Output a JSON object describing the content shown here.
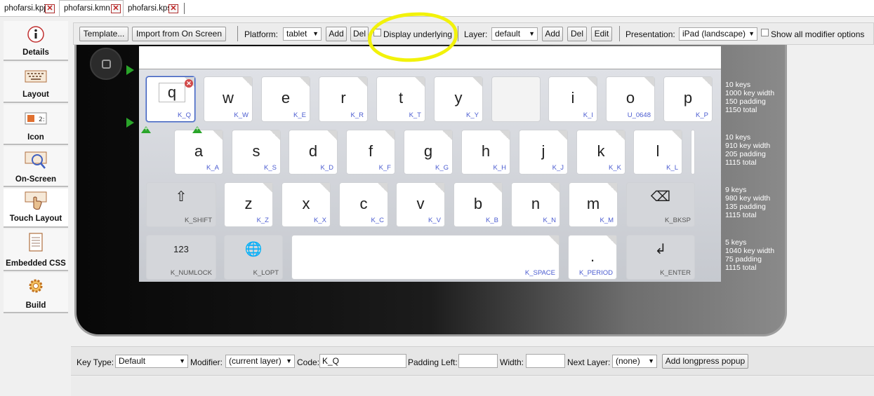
{
  "file_tabs": [
    {
      "label": "phofarsi.kpj",
      "active": false
    },
    {
      "label": "phofarsi.kmn",
      "active": true
    },
    {
      "label": "phofarsi.kps",
      "active": false
    }
  ],
  "sidebar": {
    "items": [
      {
        "label": "Details",
        "icon": "info-icon"
      },
      {
        "label": "Layout",
        "icon": "keyboard-icon"
      },
      {
        "label": "Icon",
        "icon": "bitmap-icon"
      },
      {
        "label": "On-Screen",
        "icon": "on-screen-keyboard-icon"
      },
      {
        "label": "Touch Layout",
        "icon": "touch-icon",
        "active": true
      },
      {
        "label": "Embedded CSS",
        "icon": "document-icon"
      },
      {
        "label": "Build",
        "icon": "gear-icon"
      }
    ]
  },
  "toolbar": {
    "template_label": "Template...",
    "import_label": "Import from On Screen",
    "platform_label": "Platform:",
    "platform_value": "tablet",
    "platform_add": "Add",
    "platform_del": "Del",
    "display_underlying": "Display underlying",
    "layer_label": "Layer:",
    "layer_value": "default",
    "layer_add": "Add",
    "layer_del": "Del",
    "layer_edit": "Edit",
    "presentation_label": "Presentation:",
    "presentation_value": "iPad (landscape)",
    "show_all_modifiers": "Show all modifier options"
  },
  "keyboard": {
    "rows": [
      {
        "info": [
          "10 keys",
          "1000 key width",
          "150 padding",
          "1150 total"
        ],
        "keys": [
          {
            "cap": "q",
            "code": "K_Q",
            "selected": true
          },
          {
            "cap": "w",
            "code": "K_W"
          },
          {
            "cap": "e",
            "code": "K_E"
          },
          {
            "cap": "r",
            "code": "K_R"
          },
          {
            "cap": "t",
            "code": "K_T"
          },
          {
            "cap": "y",
            "code": "K_Y"
          },
          {
            "cap": "",
            "code": "",
            "blank": true
          },
          {
            "cap": "i",
            "code": "K_I"
          },
          {
            "cap": "o",
            "code": "U_0648"
          },
          {
            "cap": "p",
            "code": "K_P"
          }
        ]
      },
      {
        "info": [
          "10 keys",
          "910 key width",
          "205 padding",
          "1115 total"
        ],
        "keys": [
          {
            "cap": "a",
            "code": "K_A"
          },
          {
            "cap": "s",
            "code": "K_S"
          },
          {
            "cap": "d",
            "code": "K_D"
          },
          {
            "cap": "f",
            "code": "K_F"
          },
          {
            "cap": "g",
            "code": "K_G"
          },
          {
            "cap": "h",
            "code": "K_H"
          },
          {
            "cap": "j",
            "code": "K_J"
          },
          {
            "cap": "k",
            "code": "K_K"
          },
          {
            "cap": "l",
            "code": "K_L"
          },
          {
            "cap": "",
            "code": "",
            "blank": true
          }
        ]
      },
      {
        "info": [
          "9 keys",
          "980 key width",
          "135 padding",
          "1115 total"
        ],
        "keys": [
          {
            "cap": "⇧",
            "code": "K_SHIFT",
            "special": true
          },
          {
            "cap": "z",
            "code": "K_Z"
          },
          {
            "cap": "x",
            "code": "K_X"
          },
          {
            "cap": "c",
            "code": "K_C"
          },
          {
            "cap": "v",
            "code": "K_V"
          },
          {
            "cap": "b",
            "code": "K_B"
          },
          {
            "cap": "n",
            "code": "K_N"
          },
          {
            "cap": "m",
            "code": "K_M"
          },
          {
            "cap": "⌫",
            "code": "K_BKSP",
            "special": true
          }
        ]
      },
      {
        "info": [
          "5 keys",
          "1040 key width",
          "75 padding",
          "1115 total"
        ],
        "keys": [
          {
            "cap": "123",
            "code": "K_NUMLOCK",
            "special": true
          },
          {
            "cap": "🌐",
            "code": "K_LOPT",
            "special": true
          },
          {
            "cap": "",
            "code": "K_SPACE"
          },
          {
            "cap": ".",
            "code": "K_PERIOD"
          },
          {
            "cap": "↲",
            "code": "K_ENTER",
            "special": true
          }
        ]
      }
    ]
  },
  "properties": {
    "key_type_label": "Key Type:",
    "key_type_value": "Default",
    "modifier_label": "Modifier:",
    "modifier_value": "(current layer)",
    "code_label": "Code:",
    "code_value": "K_Q",
    "padding_left_label": "Padding Left:",
    "padding_left_value": "",
    "width_label": "Width:",
    "width_value": "",
    "next_layer_label": "Next Layer:",
    "next_layer_value": "(none)",
    "longpress_label": "Add longpress popup"
  },
  "colors": {
    "annotation": "#f2f20a",
    "key_code_text": "#4a5bd0",
    "marker": "#2aa52a"
  }
}
